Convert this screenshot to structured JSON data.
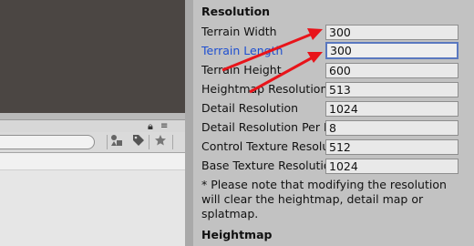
{
  "inspector": {
    "resolution_title": "Resolution",
    "fields": [
      {
        "label": "Terrain Width",
        "value": "300"
      },
      {
        "label": "Terrain Length",
        "value": "300"
      },
      {
        "label": "Terrain Height",
        "value": "600"
      },
      {
        "label": "Heightmap Resolution",
        "value": "513"
      },
      {
        "label": "Detail Resolution",
        "value": "1024"
      },
      {
        "label": "Detail Resolution Per Patch",
        "value": "8"
      },
      {
        "label": "Control Texture Resolution",
        "value": "512"
      },
      {
        "label": "Base Texture Resolution",
        "value": "1024"
      }
    ],
    "note": "* Please note that modifying the resolution will clear the heightmap, detail map or splatmap.",
    "heightmap_title": "Heightmap"
  },
  "project_panel": {
    "icons": [
      "lock-icon",
      "panel-menu-icon",
      "search-field",
      "filter-by-type-icon",
      "filter-by-label-icon",
      "favorites-star-icon"
    ]
  },
  "annotations": {
    "arrow_color": "#e8141a"
  }
}
